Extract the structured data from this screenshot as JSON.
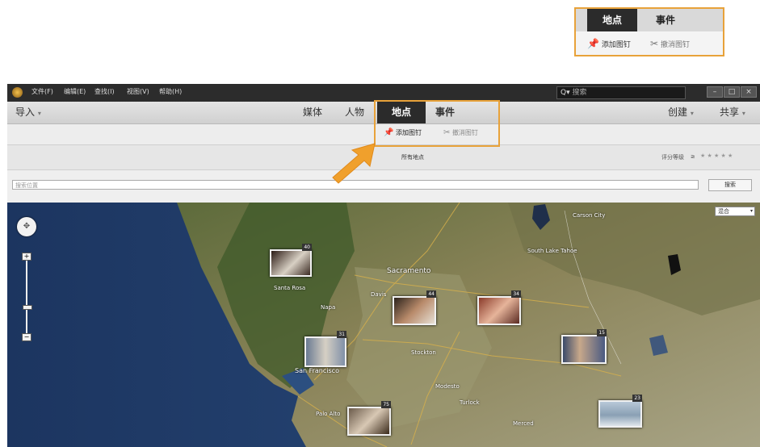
{
  "callout": {
    "tabs": [
      "地点",
      "事件"
    ],
    "add_pin": "添加图钉",
    "remove_pin": "撤消图钉"
  },
  "window": {
    "menu": [
      "文件(F)",
      "编辑(E)",
      "查找(I)",
      "视图(V)",
      "帮助(H)"
    ],
    "search_placeholder": "搜索",
    "window_buttons": [
      "–",
      "□",
      "×"
    ]
  },
  "toolbar": {
    "import": "导入",
    "tabs": [
      "媒体",
      "人物",
      "地点",
      "事件"
    ],
    "create": "创建",
    "share": "共享"
  },
  "places_bar": {
    "add_pin": "添加图钉",
    "remove_pin": "撤消图钉"
  },
  "filter_bar": {
    "all_places": "所有地点",
    "rating_label": "评分等级",
    "rating_value": "≥",
    "stars": "★ ★ ★ ★ ★"
  },
  "location_search": {
    "placeholder": "搜索位置",
    "button": "搜索"
  },
  "map": {
    "type_select": "混合",
    "labels": [
      "Sacramento",
      "Santa Rosa",
      "Napa",
      "Davis",
      "Stockton",
      "San Francisco",
      "Modesto",
      "Turlock",
      "Merced",
      "Carson City",
      "South Lake Tahoe",
      "Palo Alto"
    ],
    "pins": [
      {
        "count": "40"
      },
      {
        "count": "44"
      },
      {
        "count": "34"
      },
      {
        "count": "31"
      },
      {
        "count": "15"
      },
      {
        "count": "75"
      },
      {
        "count": "23"
      }
    ]
  },
  "colors": {
    "highlight": "#e8a23a",
    "title_bar": "#2c2c2c",
    "active_tab": "#2b2b2b"
  }
}
